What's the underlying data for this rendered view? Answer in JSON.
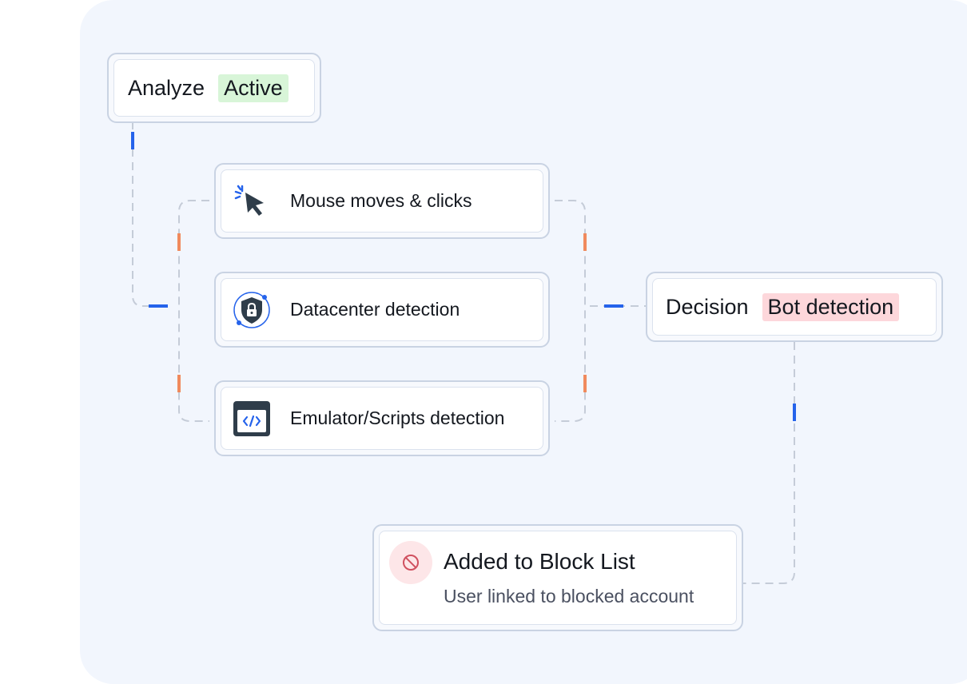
{
  "analyze": {
    "title": "Analyze",
    "status": "Active"
  },
  "signals": [
    {
      "label": "Mouse moves & clicks",
      "icon": "cursor-click-icon"
    },
    {
      "label": "Datacenter detection",
      "icon": "shield-lock-icon"
    },
    {
      "label": "Emulator/Scripts detection",
      "icon": "code-window-icon"
    }
  ],
  "decision": {
    "title": "Decision",
    "status": "Bot detection"
  },
  "result": {
    "title": "Added to Block List",
    "subtitle": "User linked to blocked account",
    "icon": "block-icon"
  },
  "colors": {
    "background": "#f2f6fd",
    "connector": "#c5ccd8",
    "accent_blue": "#2563eb",
    "accent_orange": "#f08a5d",
    "active_chip": "#d8f5d8",
    "alert_chip": "#fdd7db"
  }
}
